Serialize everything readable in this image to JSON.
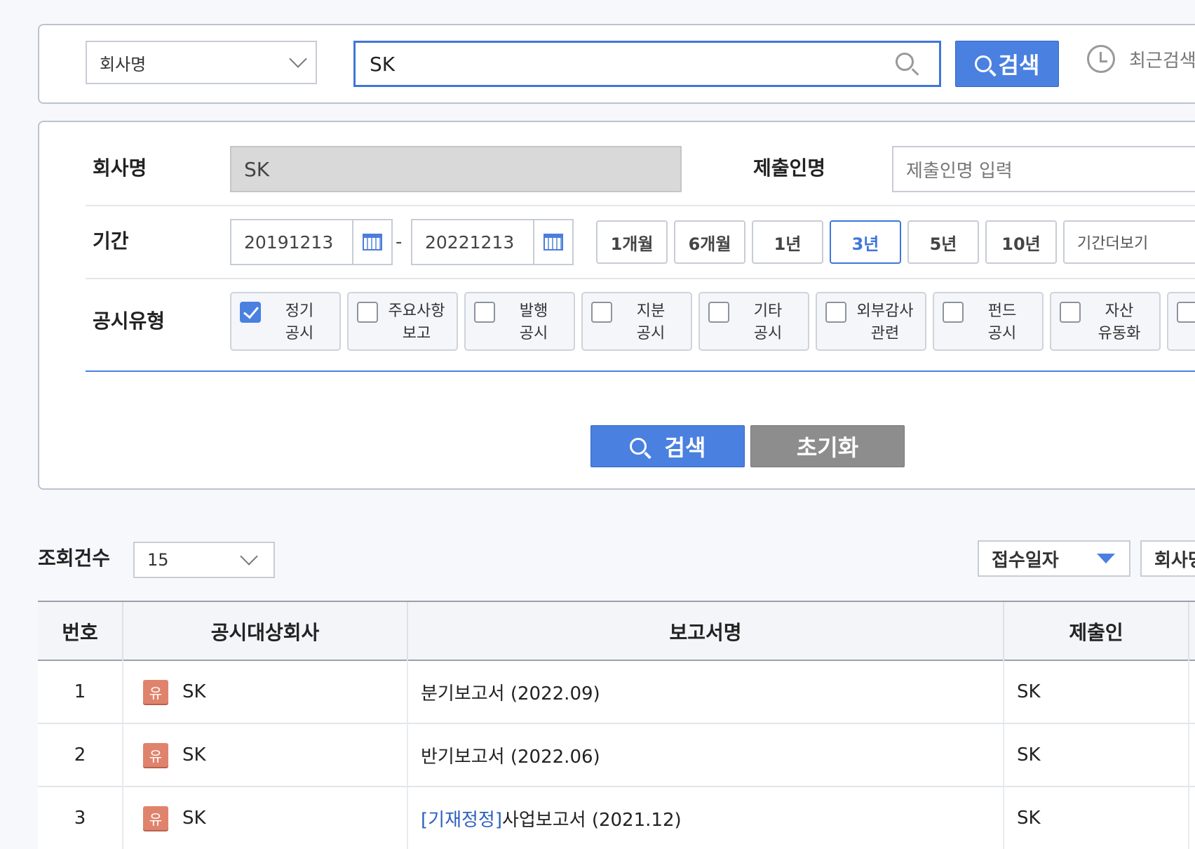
{
  "top_search": {
    "category": "회사명",
    "query": "SK",
    "search_label": "검색",
    "recent_label": "최근검색"
  },
  "filter": {
    "company_label": "회사명",
    "company_value": "SK",
    "submitter_label": "제출인명",
    "submitter_placeholder": "제출인명 입력",
    "period_label": "기간",
    "date_from": "20191213",
    "date_sep": "-",
    "date_to": "20221213",
    "periods": [
      "1개월",
      "6개월",
      "1년",
      "3년",
      "5년",
      "10년"
    ],
    "active_period": "3년",
    "period_more": "기간더보기",
    "type_label": "공시유형",
    "types": [
      {
        "line1": "정기",
        "line2": "공시",
        "checked": true
      },
      {
        "line1": "주요사항",
        "line2": "보고",
        "checked": false
      },
      {
        "line1": "발행",
        "line2": "공시",
        "checked": false
      },
      {
        "line1": "지분",
        "line2": "공시",
        "checked": false
      },
      {
        "line1": "기타",
        "line2": "공시",
        "checked": false
      },
      {
        "line1": "외부감사",
        "line2": "관련",
        "checked": false
      },
      {
        "line1": "펀드",
        "line2": "공시",
        "checked": false
      },
      {
        "line1": "자산",
        "line2": "유동화",
        "checked": false
      }
    ],
    "search_label": "검색",
    "reset_label": "초기화"
  },
  "results": {
    "count_label": "조회건수",
    "page_size": "15",
    "sort_label": "접수일자",
    "sort2_label": "회사명",
    "columns": [
      "번호",
      "공시대상회사",
      "보고서명",
      "제출인"
    ],
    "rows": [
      {
        "no": "1",
        "badge": "유",
        "company": "SK",
        "prefix": "",
        "report": "분기보고서 (2022.09)",
        "submitter": "SK"
      },
      {
        "no": "2",
        "badge": "유",
        "company": "SK",
        "prefix": "",
        "report": "반기보고서 (2022.06)",
        "submitter": "SK"
      },
      {
        "no": "3",
        "badge": "유",
        "company": "SK",
        "prefix": "[기재정정]",
        "report": "사업보고서 (2021.12)",
        "submitter": "SK"
      }
    ]
  }
}
